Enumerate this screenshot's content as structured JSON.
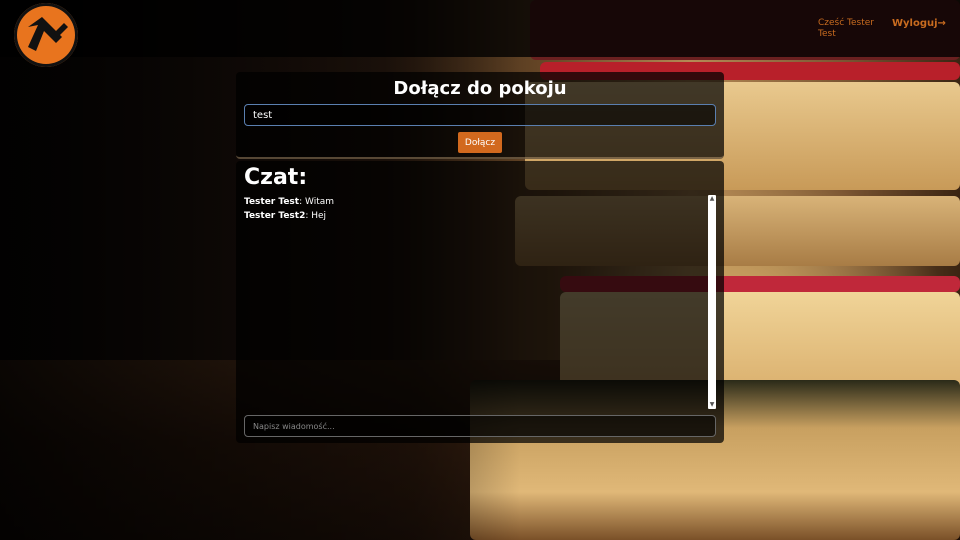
{
  "header": {
    "logo_icon": "lambda-logo-icon",
    "greeting": "Cześć Tester Test",
    "logout_label": "Wyloguj→"
  },
  "join": {
    "title": "Dołącz do pokoju",
    "room_value": "test",
    "join_label": "Dołącz"
  },
  "chat": {
    "title": "Czat:",
    "messages": [
      {
        "author": "Tester Test",
        "text": ": Witam"
      },
      {
        "author": "Tester Test2",
        "text": ": Hej"
      }
    ],
    "input_placeholder": "Napisz wiadomość..."
  },
  "colors": {
    "accent": "#d2691e",
    "panel": "rgba(0,0,0,0.72)"
  }
}
